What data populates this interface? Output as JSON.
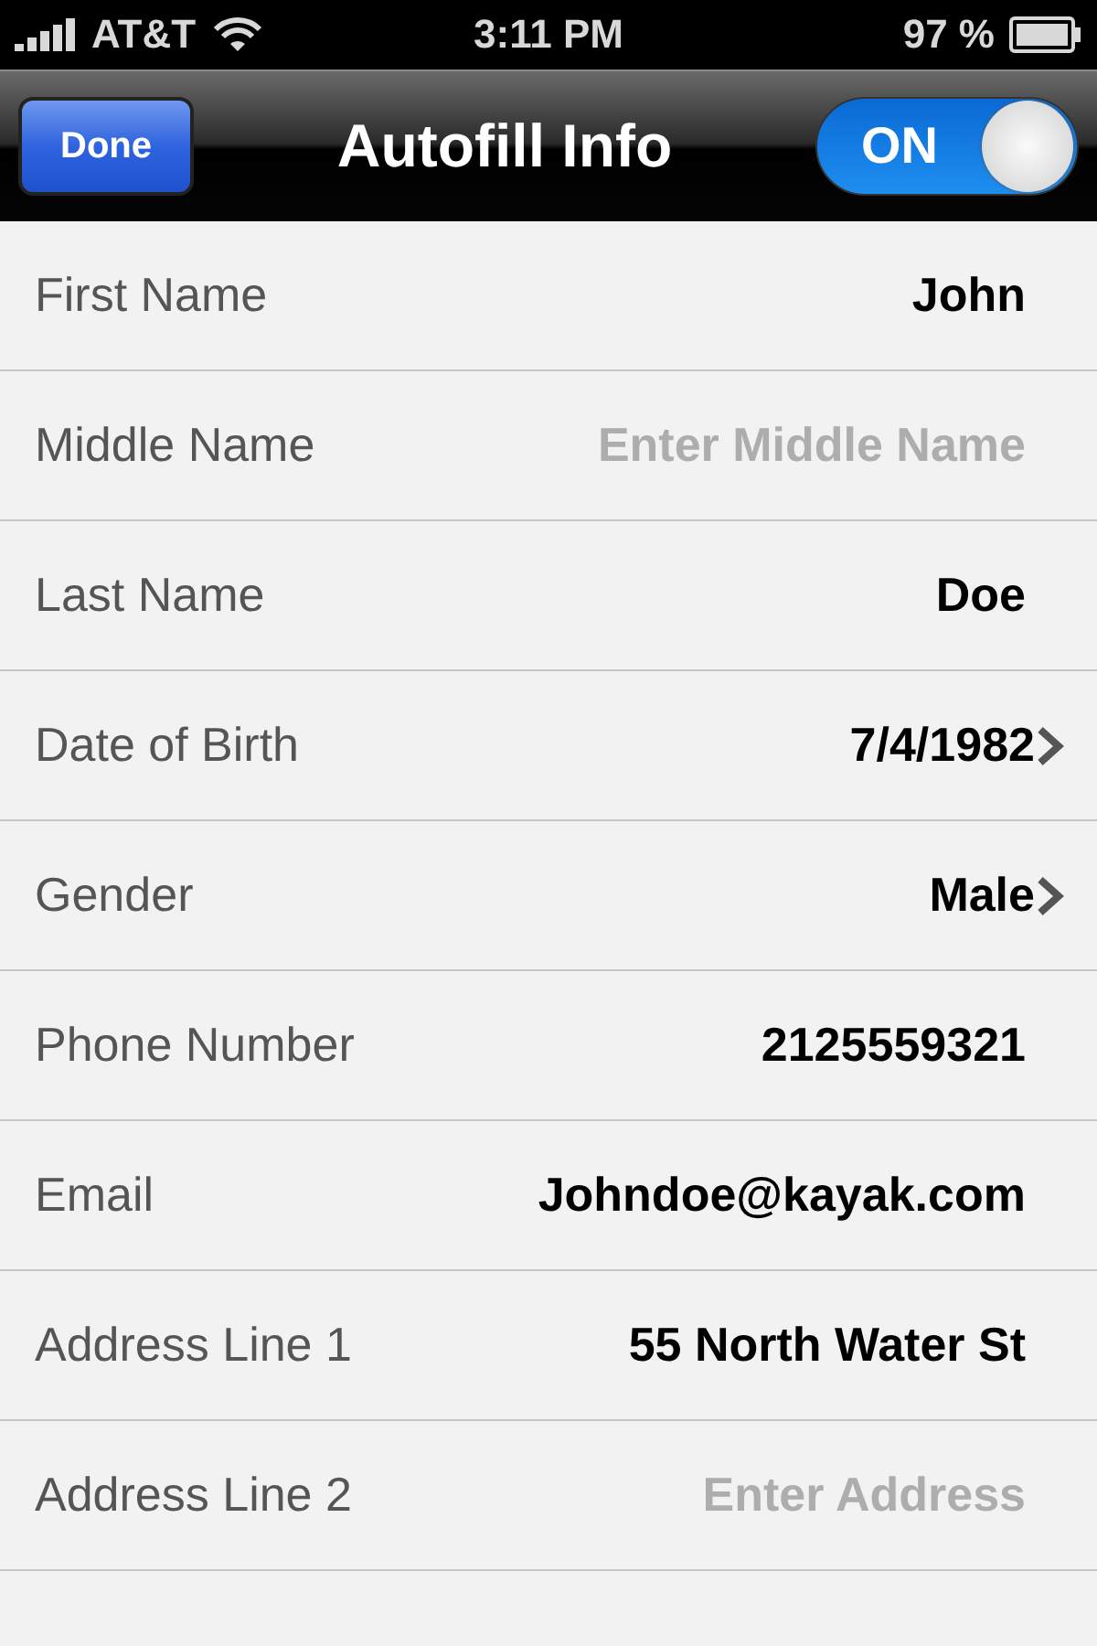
{
  "status_bar": {
    "carrier": "AT&T",
    "time": "3:11 PM",
    "battery": "97 %"
  },
  "nav_bar": {
    "button": "Done",
    "title": "Autofill Info",
    "toggle": {
      "label": "ON",
      "on": true
    }
  },
  "rows": [
    {
      "kind": "field",
      "label": "First Name",
      "value": "John"
    },
    {
      "kind": "field",
      "label": "Middle Name",
      "placeholder": "Enter Middle Name"
    },
    {
      "kind": "field",
      "label": "Last Name",
      "value": "Doe"
    },
    {
      "kind": "picker",
      "label": "Date of Birth",
      "value": "7/4/1982"
    },
    {
      "kind": "picker",
      "label": "Gender",
      "value": "Male"
    },
    {
      "kind": "field",
      "label": "Phone Number",
      "value": "2125559321"
    },
    {
      "kind": "field",
      "label": "Email",
      "value": "Johndoe@kayak.com"
    },
    {
      "kind": "field",
      "label": "Address Line 1",
      "value": "55 North Water St"
    },
    {
      "kind": "field",
      "label": "Address Line 2",
      "placeholder": "Enter Address"
    }
  ]
}
